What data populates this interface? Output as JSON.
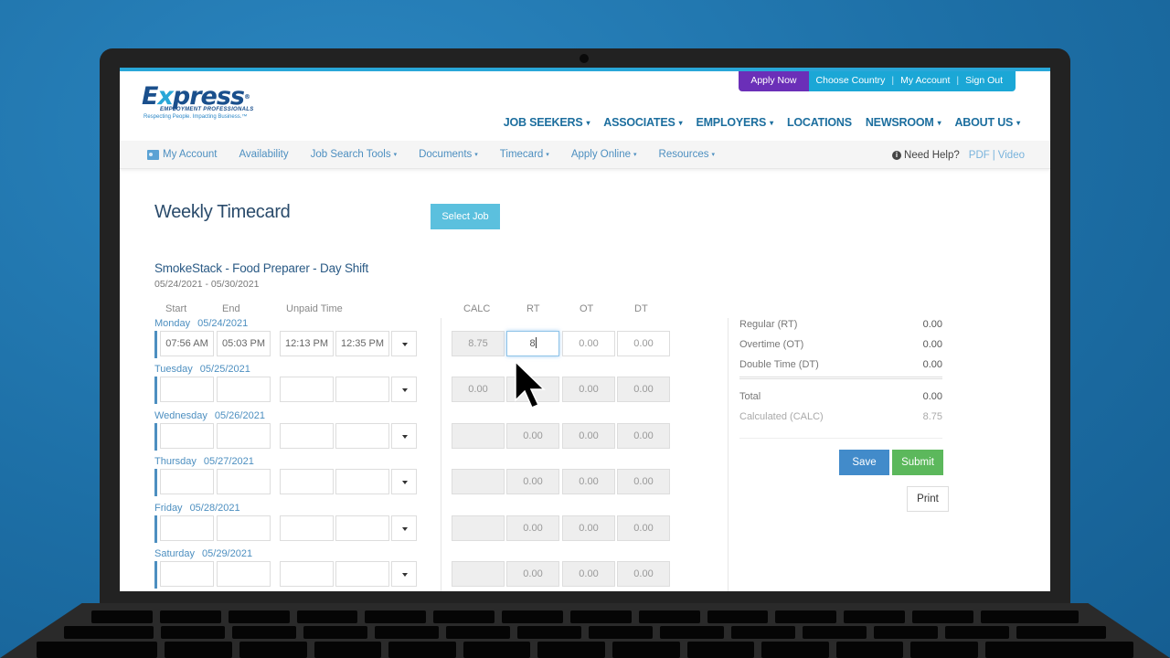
{
  "utility_bar": {
    "apply_now": "Apply Now",
    "links": [
      "Choose Country",
      "My Account",
      "Sign Out"
    ],
    "apply_color": "#6b2fb8",
    "links_color": "#1ba7d6"
  },
  "logo": {
    "word_pre": "E",
    "word_x": "x",
    "word_post": "press",
    "reg": "®",
    "subtitle": "EMPLOYMENT PROFESSIONALS",
    "tagline": "Respecting People. Impacting Business.™"
  },
  "main_nav": [
    {
      "label": "JOB SEEKERS",
      "dropdown": true
    },
    {
      "label": "ASSOCIATES",
      "dropdown": true
    },
    {
      "label": "EMPLOYERS",
      "dropdown": true
    },
    {
      "label": "LOCATIONS",
      "dropdown": false
    },
    {
      "label": "NEWSROOM",
      "dropdown": true
    },
    {
      "label": "ABOUT US",
      "dropdown": true
    }
  ],
  "sub_nav": [
    {
      "label": "My Account",
      "icon": "id-card-icon"
    },
    {
      "label": "Availability"
    },
    {
      "label": "Job Search Tools",
      "dropdown": true
    },
    {
      "label": "Documents",
      "dropdown": true
    },
    {
      "label": "Timecard",
      "dropdown": true
    },
    {
      "label": "Apply Online",
      "dropdown": true
    },
    {
      "label": "Resources",
      "dropdown": true
    }
  ],
  "help": {
    "label": "Need Help?",
    "pdf": "PDF",
    "sep": "|",
    "video": "Video"
  },
  "caret_glyph": "▾",
  "page": {
    "title": "Weekly Timecard",
    "select_job": "Select Job",
    "job_title": "SmokeStack - Food Preparer - Day Shift",
    "job_dates": "05/24/2021 - 05/30/2021"
  },
  "columns": {
    "start": "Start",
    "end": "End",
    "unpaid": "Unpaid Time",
    "calc": "CALC",
    "rt": "RT",
    "ot": "OT",
    "dt": "DT"
  },
  "days": [
    {
      "day": "Monday",
      "date": "05/24/2021",
      "start": "07:56 AM",
      "end": "05:03 PM",
      "unpaid_start": "12:13 PM",
      "unpaid_end": "12:35 PM",
      "calc": "8.75",
      "rt": "8",
      "ot": "0.00",
      "dt": "0.00"
    },
    {
      "day": "Tuesday",
      "date": "05/25/2021",
      "start": "",
      "end": "",
      "unpaid_start": "",
      "unpaid_end": "",
      "calc": "0.00",
      "rt": "",
      "ot": "0.00",
      "dt": "0.00"
    },
    {
      "day": "Wednesday",
      "date": "05/26/2021",
      "start": "",
      "end": "",
      "unpaid_start": "",
      "unpaid_end": "",
      "calc": "",
      "rt": "0.00",
      "ot": "0.00",
      "dt": "0.00"
    },
    {
      "day": "Thursday",
      "date": "05/27/2021",
      "start": "",
      "end": "",
      "unpaid_start": "",
      "unpaid_end": "",
      "calc": "",
      "rt": "0.00",
      "ot": "0.00",
      "dt": "0.00"
    },
    {
      "day": "Friday",
      "date": "05/28/2021",
      "start": "",
      "end": "",
      "unpaid_start": "",
      "unpaid_end": "",
      "calc": "",
      "rt": "0.00",
      "ot": "0.00",
      "dt": "0.00"
    },
    {
      "day": "Saturday",
      "date": "05/29/2021",
      "start": "",
      "end": "",
      "unpaid_start": "",
      "unpaid_end": "",
      "calc": "",
      "rt": "0.00",
      "ot": "0.00",
      "dt": "0.00"
    }
  ],
  "summary": {
    "regular_label": "Regular (RT)",
    "regular": "0.00",
    "overtime_label": "Overtime (OT)",
    "overtime": "0.00",
    "double_label": "Double Time (DT)",
    "double": "0.00",
    "total_label": "Total",
    "total": "0.00",
    "calc_label": "Calculated (CALC)",
    "calc": "8.75"
  },
  "actions": {
    "save": "Save",
    "submit": "Submit",
    "print": "Print"
  }
}
